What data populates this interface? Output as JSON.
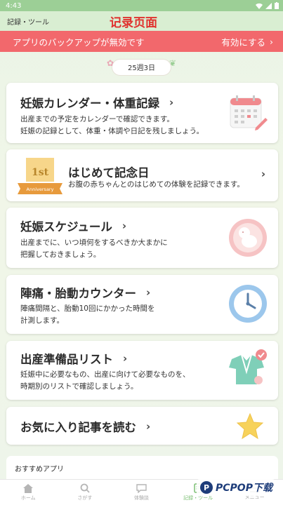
{
  "status_bar": {
    "time": "4:43"
  },
  "header": {
    "title": "記録・ツール",
    "overlay_title": "记录页面"
  },
  "backup_banner": {
    "message": "アプリのバックアップが無効です",
    "action": "有効にする"
  },
  "week_badge": "25週3日",
  "cards": [
    {
      "title": "妊娠カレンダー・体重記録",
      "desc_lines": [
        "出産までの予定をカレンダーで確認できます。",
        "妊娠の記録として、体重・体調や日記を残しましょう。"
      ],
      "icon": "calendar-icon"
    },
    {
      "title": "はじめて記念日",
      "desc_lines": [
        "お腹の赤ちゃんとのはじめての体験を記録できます。"
      ],
      "badge_top": "1st",
      "badge_bottom": "Anniversary",
      "icon": "anniversary-badge-icon"
    },
    {
      "title": "妊娠スケジュール",
      "desc_lines": [
        "出産までに、いつ頃何をするべきか大まかに",
        "把握しておきましょう。"
      ],
      "icon": "baby-icon"
    },
    {
      "title": "陣痛・胎動カウンター",
      "desc_lines": [
        "陣痛間隔と、胎動10回にかかった時間を",
        "計測します。"
      ],
      "icon": "clock-icon"
    },
    {
      "title": "出産準備品リスト",
      "desc_lines": [
        "妊娠中に必要なもの、出産に向けて必要なものを、",
        "時期別のリストで確認しましょう。"
      ],
      "icon": "baby-clothes-icon"
    },
    {
      "title": "お気に入り記事を読む",
      "icon": "star-icon"
    }
  ],
  "recommend": {
    "label": "おすすめアプリ"
  },
  "bottom_nav": [
    {
      "label": "ホーム",
      "icon": "home-icon"
    },
    {
      "label": "さがす",
      "icon": "search-icon"
    },
    {
      "label": "体験談",
      "icon": "chat-icon"
    },
    {
      "label": "記録・ツール",
      "icon": "tools-icon"
    },
    {
      "label": "メニュー",
      "icon": "menu-icon"
    }
  ],
  "watermark": {
    "text": "PCPOP下载"
  },
  "colors": {
    "accent": "#9ccf96",
    "banner": "#f2686c",
    "active": "#7cbf74"
  }
}
